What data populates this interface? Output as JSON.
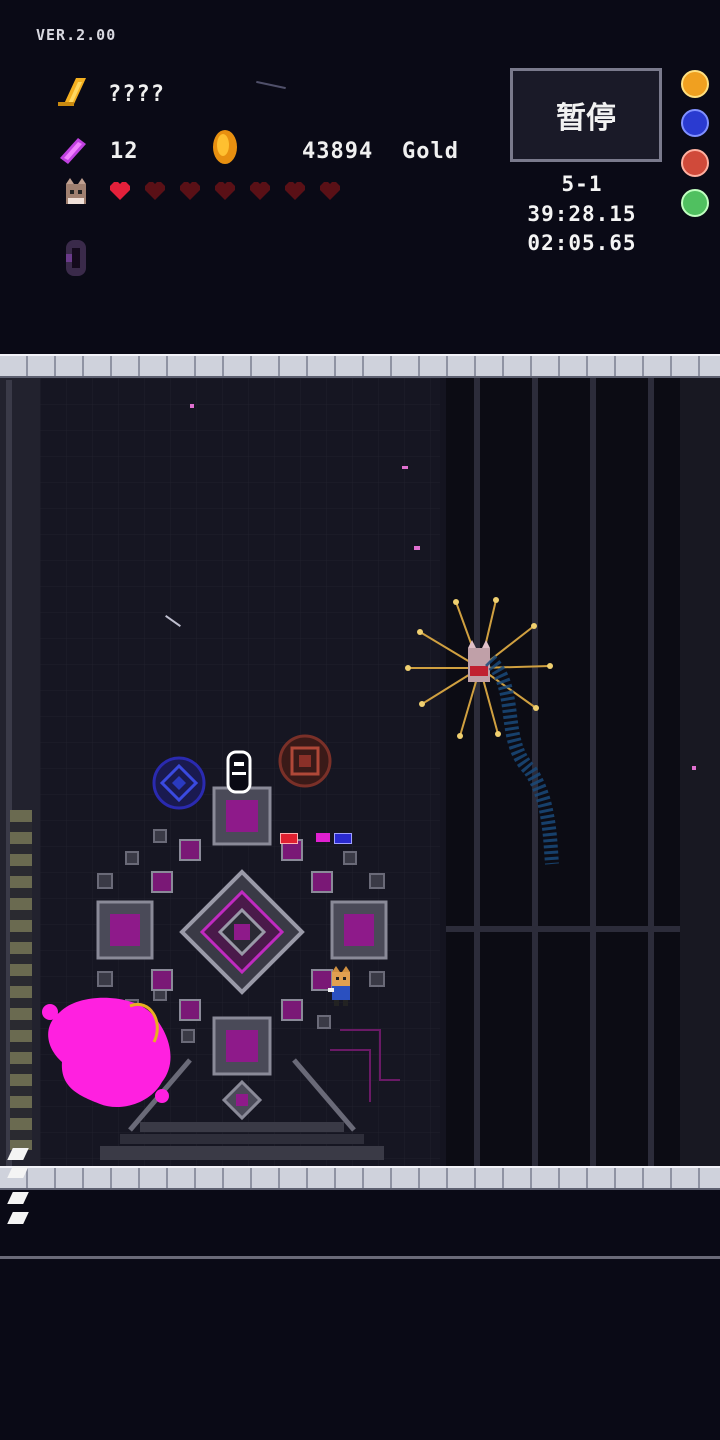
{
  "version": "VER.2.00",
  "hud": {
    "weapon_name": "????",
    "ammo_count": "12",
    "gold_amount": "43894",
    "gold_label": "Gold",
    "hearts_total": 7,
    "hearts_full": 1
  },
  "pause_label": "暂停",
  "stage": "5-1",
  "total_time": "39:28.15",
  "stage_time": "02:05.65",
  "orbs": [
    {
      "name": "gold-orb-icon",
      "color": "#f0a020"
    },
    {
      "name": "blue-orb-icon",
      "color": "#3a50e0"
    },
    {
      "name": "red-orb-icon",
      "color": "#e05040"
    },
    {
      "name": "green-orb-icon",
      "color": "#60d070"
    }
  ],
  "colors": {
    "heart_full": "#e4203a",
    "heart_empty": "#5a1016",
    "magenta": "#ff20e0",
    "machine_core": "#8e1a8a"
  }
}
